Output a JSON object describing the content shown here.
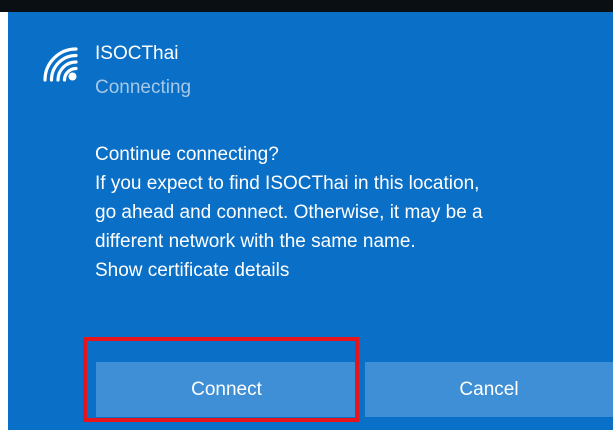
{
  "network": {
    "name": "ISOCThai",
    "status": "Connecting",
    "icon": "wifi-signal-icon"
  },
  "message": {
    "lines": [
      "Continue connecting?",
      "If you expect to find ISOCThai in this location,",
      "go ahead and connect. Otherwise, it may be a",
      "different network with the same name."
    ],
    "certificate_link": "Show certificate details"
  },
  "actions": {
    "connect_label": "Connect",
    "cancel_label": "Cancel"
  },
  "colors": {
    "panel_background": "#0a6fc7",
    "button_background": "#3e8fd6",
    "status_text": "#a6c8e6",
    "highlight": "#e8141c"
  }
}
